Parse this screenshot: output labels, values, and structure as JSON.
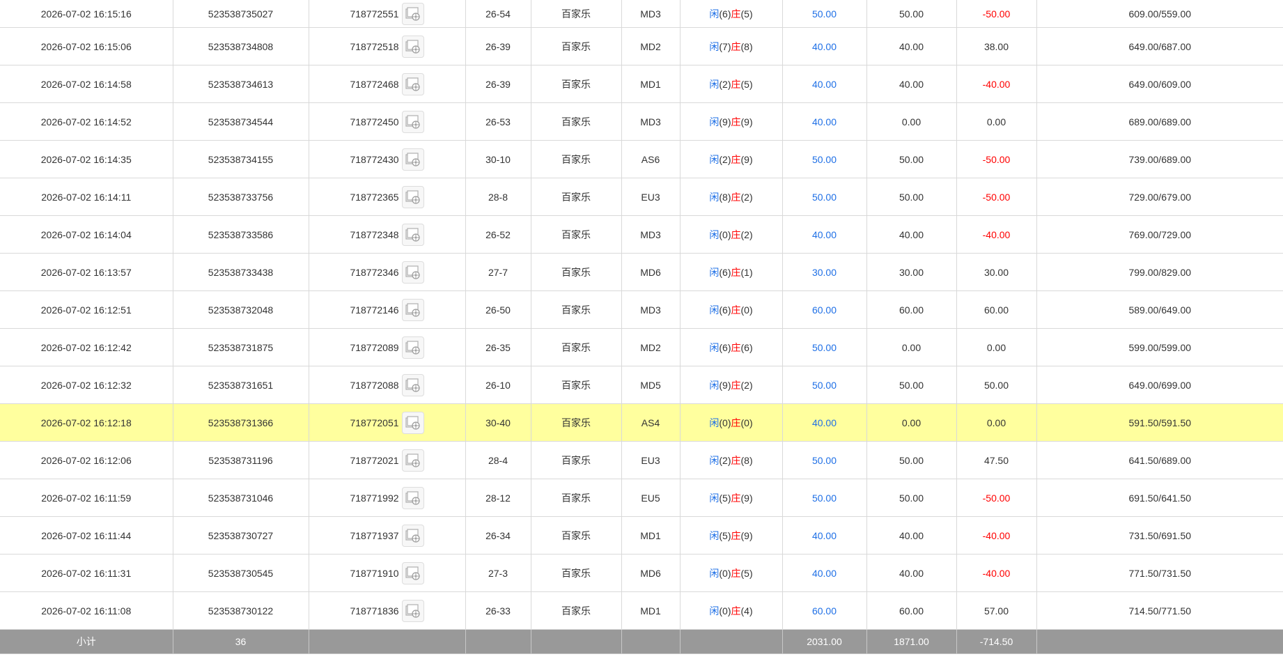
{
  "table": {
    "rows": [
      {
        "time": "2026-07-02 16:15:16",
        "bet_no": "523538735027",
        "game_no": "718772551",
        "shoe": "26-54",
        "game": "百家乐",
        "table": "MD3",
        "player_label": "闲",
        "player_val": "(6)",
        "banker_label": "庄",
        "banker_val": "(5)",
        "bet": "50.00",
        "valid": "50.00",
        "winloss": "-50.00",
        "winloss_negative": true,
        "balance": "609.00/559.00",
        "highlight": false,
        "video_icon": "video-replay-icon"
      },
      {
        "time": "2026-07-02 16:15:06",
        "bet_no": "523538734808",
        "game_no": "718772518",
        "shoe": "26-39",
        "game": "百家乐",
        "table": "MD2",
        "player_label": "闲",
        "player_val": "(7)",
        "banker_label": "庄",
        "banker_val": "(8)",
        "bet": "40.00",
        "valid": "40.00",
        "winloss": "38.00",
        "winloss_negative": false,
        "balance": "649.00/687.00",
        "highlight": false,
        "video_icon": "video-replay-icon"
      },
      {
        "time": "2026-07-02 16:14:58",
        "bet_no": "523538734613",
        "game_no": "718772468",
        "shoe": "26-39",
        "game": "百家乐",
        "table": "MD1",
        "player_label": "闲",
        "player_val": "(2)",
        "banker_label": "庄",
        "banker_val": "(5)",
        "bet": "40.00",
        "valid": "40.00",
        "winloss": "-40.00",
        "winloss_negative": true,
        "balance": "649.00/609.00",
        "highlight": false,
        "video_icon": "video-replay-icon"
      },
      {
        "time": "2026-07-02 16:14:52",
        "bet_no": "523538734544",
        "game_no": "718772450",
        "shoe": "26-53",
        "game": "百家乐",
        "table": "MD3",
        "player_label": "闲",
        "player_val": "(9)",
        "banker_label": "庄",
        "banker_val": "(9)",
        "bet": "40.00",
        "valid": "0.00",
        "winloss": "0.00",
        "winloss_negative": false,
        "balance": "689.00/689.00",
        "highlight": false,
        "video_icon": "video-replay-icon"
      },
      {
        "time": "2026-07-02 16:14:35",
        "bet_no": "523538734155",
        "game_no": "718772430",
        "shoe": "30-10",
        "game": "百家乐",
        "table": "AS6",
        "player_label": "闲",
        "player_val": "(2)",
        "banker_label": "庄",
        "banker_val": "(9)",
        "bet": "50.00",
        "valid": "50.00",
        "winloss": "-50.00",
        "winloss_negative": true,
        "balance": "739.00/689.00",
        "highlight": false,
        "video_icon": "video-replay-icon"
      },
      {
        "time": "2026-07-02 16:14:11",
        "bet_no": "523538733756",
        "game_no": "718772365",
        "shoe": "28-8",
        "game": "百家乐",
        "table": "EU3",
        "player_label": "闲",
        "player_val": "(8)",
        "banker_label": "庄",
        "banker_val": "(2)",
        "bet": "50.00",
        "valid": "50.00",
        "winloss": "-50.00",
        "winloss_negative": true,
        "balance": "729.00/679.00",
        "highlight": false,
        "video_icon": "video-replay-icon"
      },
      {
        "time": "2026-07-02 16:14:04",
        "bet_no": "523538733586",
        "game_no": "718772348",
        "shoe": "26-52",
        "game": "百家乐",
        "table": "MD3",
        "player_label": "闲",
        "player_val": "(0)",
        "banker_label": "庄",
        "banker_val": "(2)",
        "bet": "40.00",
        "valid": "40.00",
        "winloss": "-40.00",
        "winloss_negative": true,
        "balance": "769.00/729.00",
        "highlight": false,
        "video_icon": "video-replay-icon"
      },
      {
        "time": "2026-07-02 16:13:57",
        "bet_no": "523538733438",
        "game_no": "718772346",
        "shoe": "27-7",
        "game": "百家乐",
        "table": "MD6",
        "player_label": "闲",
        "player_val": "(6)",
        "banker_label": "庄",
        "banker_val": "(1)",
        "bet": "30.00",
        "valid": "30.00",
        "winloss": "30.00",
        "winloss_negative": false,
        "balance": "799.00/829.00",
        "highlight": false,
        "video_icon": "video-replay-icon"
      },
      {
        "time": "2026-07-02 16:12:51",
        "bet_no": "523538732048",
        "game_no": "718772146",
        "shoe": "26-50",
        "game": "百家乐",
        "table": "MD3",
        "player_label": "闲",
        "player_val": "(6)",
        "banker_label": "庄",
        "banker_val": "(0)",
        "bet": "60.00",
        "valid": "60.00",
        "winloss": "60.00",
        "winloss_negative": false,
        "balance": "589.00/649.00",
        "highlight": false,
        "video_icon": "video-replay-icon"
      },
      {
        "time": "2026-07-02 16:12:42",
        "bet_no": "523538731875",
        "game_no": "718772089",
        "shoe": "26-35",
        "game": "百家乐",
        "table": "MD2",
        "player_label": "闲",
        "player_val": "(6)",
        "banker_label": "庄",
        "banker_val": "(6)",
        "bet": "50.00",
        "valid": "0.00",
        "winloss": "0.00",
        "winloss_negative": false,
        "balance": "599.00/599.00",
        "highlight": false,
        "video_icon": "video-replay-icon"
      },
      {
        "time": "2026-07-02 16:12:32",
        "bet_no": "523538731651",
        "game_no": "718772088",
        "shoe": "26-10",
        "game": "百家乐",
        "table": "MD5",
        "player_label": "闲",
        "player_val": "(9)",
        "banker_label": "庄",
        "banker_val": "(2)",
        "bet": "50.00",
        "valid": "50.00",
        "winloss": "50.00",
        "winloss_negative": false,
        "balance": "649.00/699.00",
        "highlight": false,
        "video_icon": "video-replay-icon"
      },
      {
        "time": "2026-07-02 16:12:18",
        "bet_no": "523538731366",
        "game_no": "718772051",
        "shoe": "30-40",
        "game": "百家乐",
        "table": "AS4",
        "player_label": "闲",
        "player_val": "(0)",
        "banker_label": "庄",
        "banker_val": "(0)",
        "bet": "40.00",
        "valid": "0.00",
        "winloss": "0.00",
        "winloss_negative": false,
        "balance": "591.50/591.50",
        "highlight": true,
        "video_icon": "video-replay-icon"
      },
      {
        "time": "2026-07-02 16:12:06",
        "bet_no": "523538731196",
        "game_no": "718772021",
        "shoe": "28-4",
        "game": "百家乐",
        "table": "EU3",
        "player_label": "闲",
        "player_val": "(2)",
        "banker_label": "庄",
        "banker_val": "(8)",
        "bet": "50.00",
        "valid": "50.00",
        "winloss": "47.50",
        "winloss_negative": false,
        "balance": "641.50/689.00",
        "highlight": false,
        "video_icon": "video-replay-icon"
      },
      {
        "time": "2026-07-02 16:11:59",
        "bet_no": "523538731046",
        "game_no": "718771992",
        "shoe": "28-12",
        "game": "百家乐",
        "table": "EU5",
        "player_label": "闲",
        "player_val": "(5)",
        "banker_label": "庄",
        "banker_val": "(9)",
        "bet": "50.00",
        "valid": "50.00",
        "winloss": "-50.00",
        "winloss_negative": true,
        "balance": "691.50/641.50",
        "highlight": false,
        "video_icon": "video-replay-icon"
      },
      {
        "time": "2026-07-02 16:11:44",
        "bet_no": "523538730727",
        "game_no": "718771937",
        "shoe": "26-34",
        "game": "百家乐",
        "table": "MD1",
        "player_label": "闲",
        "player_val": "(5)",
        "banker_label": "庄",
        "banker_val": "(9)",
        "bet": "40.00",
        "valid": "40.00",
        "winloss": "-40.00",
        "winloss_negative": true,
        "balance": "731.50/691.50",
        "highlight": false,
        "video_icon": "video-replay-icon"
      },
      {
        "time": "2026-07-02 16:11:31",
        "bet_no": "523538730545",
        "game_no": "718771910",
        "shoe": "27-3",
        "game": "百家乐",
        "table": "MD6",
        "player_label": "闲",
        "player_val": "(0)",
        "banker_label": "庄",
        "banker_val": "(5)",
        "bet": "40.00",
        "valid": "40.00",
        "winloss": "-40.00",
        "winloss_negative": true,
        "balance": "771.50/731.50",
        "highlight": false,
        "video_icon": "video-replay-icon"
      },
      {
        "time": "2026-07-02 16:11:08",
        "bet_no": "523538730122",
        "game_no": "718771836",
        "shoe": "26-33",
        "game": "百家乐",
        "table": "MD1",
        "player_label": "闲",
        "player_val": "(0)",
        "banker_label": "庄",
        "banker_val": "(4)",
        "bet": "60.00",
        "valid": "60.00",
        "winloss": "57.00",
        "winloss_negative": false,
        "balance": "714.50/771.50",
        "highlight": false,
        "video_icon": "video-replay-icon"
      }
    ],
    "subtotal": {
      "label": "小计",
      "count": "36",
      "bet": "2031.00",
      "valid": "1871.00",
      "winloss": "-714.50"
    }
  },
  "colors": {
    "bet_blue": "#1e6fe6",
    "negative_red": "#ff0000",
    "highlight_row": "#ffff9e",
    "subtotal_bg": "#999999"
  }
}
